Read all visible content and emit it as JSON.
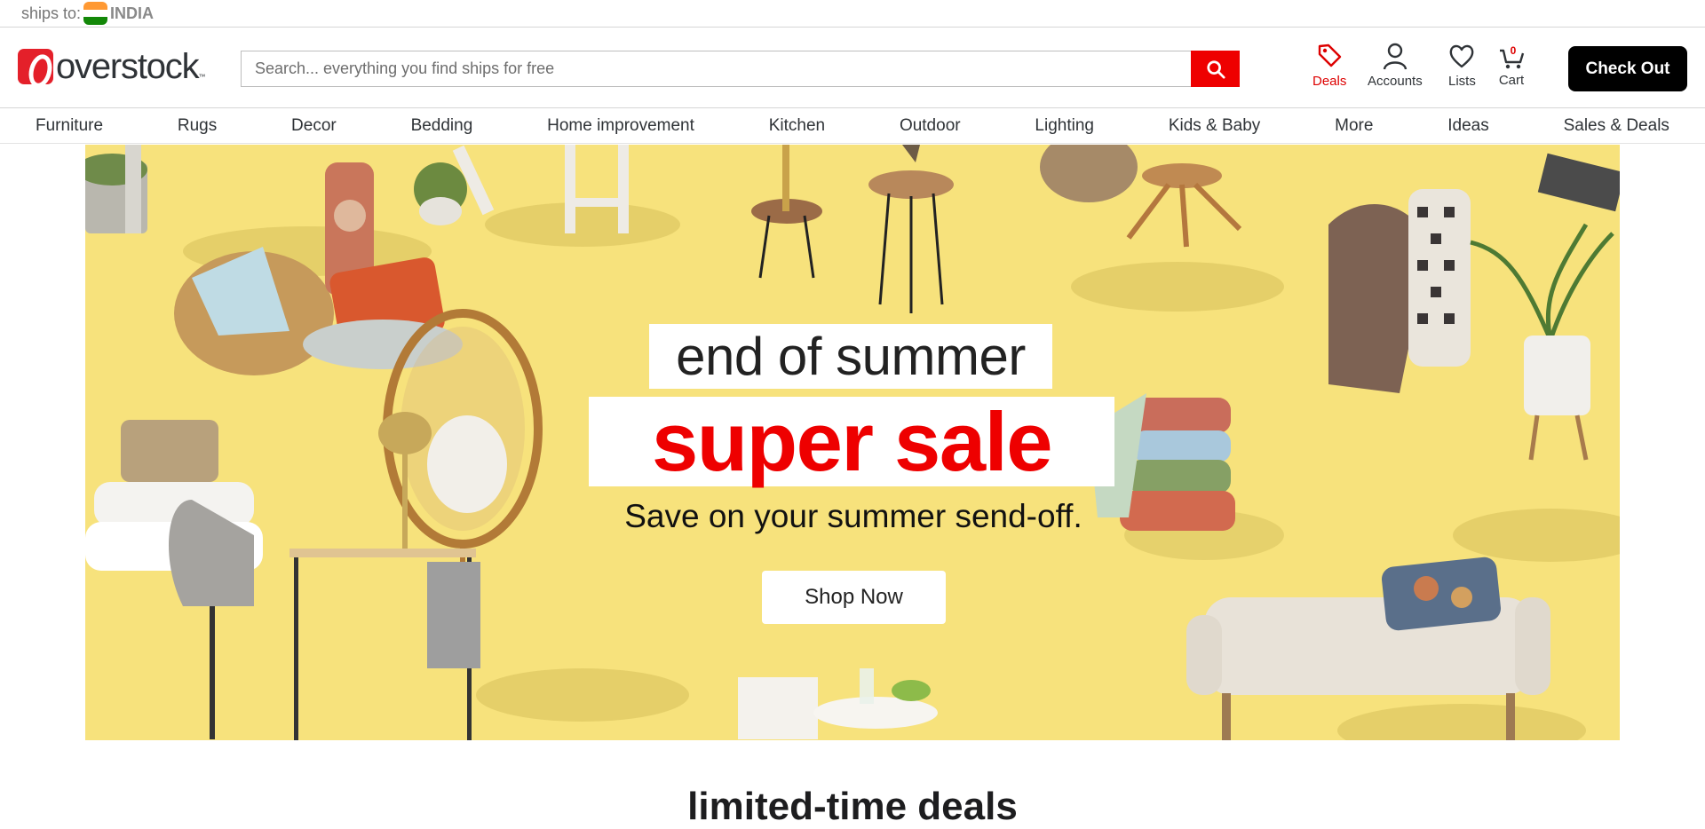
{
  "ships_bar": {
    "label": "ships to:",
    "country": "INDIA"
  },
  "header": {
    "logo_text": "overstock",
    "logo_tm": "™",
    "search": {
      "placeholder": "Search... everything you find ships for free",
      "value": ""
    },
    "icons": {
      "deals": "Deals",
      "accounts": "Accounts",
      "lists": "Lists",
      "cart": "Cart",
      "cart_count": "0"
    },
    "checkout_label": "Check Out"
  },
  "nav": {
    "items": [
      "Furniture",
      "Rugs",
      "Decor",
      "Bedding",
      "Home improvement",
      "Kitchen",
      "Outdoor",
      "Lighting",
      "Kids & Baby",
      "More",
      "Ideas",
      "Sales & Deals"
    ]
  },
  "hero": {
    "line1": "end of summer",
    "line2": "super sale",
    "line3": "Save on your summer send-off.",
    "cta": "Shop Now"
  },
  "section_title": "limited-time deals",
  "colors": {
    "brand_red": "#ee0000",
    "hero_bg": "#f7e27c",
    "checkout_bg": "#000000"
  }
}
